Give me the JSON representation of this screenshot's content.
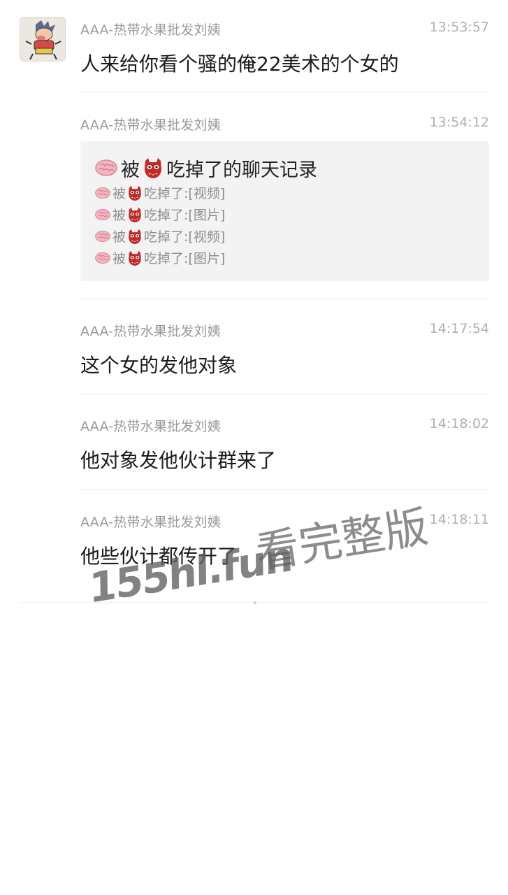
{
  "messages": [
    {
      "sender": "AAA-热带水果批发刘姨",
      "time": "13:53:57",
      "text": "人来给你看个骚的俺22美术的个女的"
    },
    {
      "sender": "AAA-热带水果批发刘姨",
      "time": "13:54:12",
      "card": {
        "title": {
          "prefix": "被",
          "suffix": "吃掉了的聊天记录"
        },
        "lines": [
          {
            "prefix": "被",
            "middle": "吃掉了: ",
            "item": "[视频]"
          },
          {
            "prefix": "被",
            "middle": "吃掉了: ",
            "item": "[图片]"
          },
          {
            "prefix": "被",
            "middle": "吃掉了: ",
            "item": "[视频]"
          },
          {
            "prefix": "被",
            "middle": "吃掉了: ",
            "item": "[图片]"
          }
        ]
      }
    },
    {
      "sender": "AAA-热带水果批发刘姨",
      "time": "14:17:54",
      "text": "这个女的发他对象"
    },
    {
      "sender": "AAA-热带水果批发刘姨",
      "time": "14:18:02",
      "text": "他对象发他伙计群来了"
    },
    {
      "sender": "AAA-热带水果批发刘姨",
      "time": "14:18:11",
      "text": "他些伙计都传开了"
    }
  ],
  "watermark": {
    "site": "155hl.fun",
    "label": "看完整版"
  },
  "icons": {
    "avatar": "cartoon-avatar",
    "brain": "brain-emoji",
    "demon": "demon-mask-emoji"
  },
  "colors": {
    "sender": "#9a9a9a",
    "time": "#b0b0b0",
    "card_bg": "#f3f3f3",
    "divider": "#ececec"
  }
}
